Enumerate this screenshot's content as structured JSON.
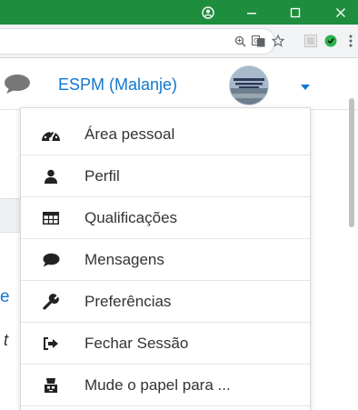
{
  "window": {
    "controls": [
      {
        "name": "account-icon"
      },
      {
        "name": "minimize-icon"
      },
      {
        "name": "maximize-icon"
      },
      {
        "name": "close-icon"
      }
    ]
  },
  "toolbar_icons": [
    "zoom-icon",
    "translate-icon",
    "bookmark-star-icon",
    "extension-icon",
    "extension-green-icon",
    "more-vert-icon"
  ],
  "header": {
    "username": "ESPM (Malanje)",
    "accent_color": "#1177d1"
  },
  "menu": {
    "items": [
      {
        "label": "Área pessoal",
        "icon": "dashboard-icon"
      },
      {
        "label": "Perfil",
        "icon": "user-icon"
      },
      {
        "label": "Qualificações",
        "icon": "table-icon"
      },
      {
        "label": "Mensagens",
        "icon": "message-icon"
      },
      {
        "label": "Preferências",
        "icon": "wrench-icon"
      },
      {
        "label": "Fechar Sessão",
        "icon": "sign-out-icon"
      },
      {
        "label": "Mude o papel para ...",
        "icon": "role-icon"
      }
    ]
  },
  "page_fragments": {
    "link_edge": "e",
    "text_edge": "t"
  }
}
